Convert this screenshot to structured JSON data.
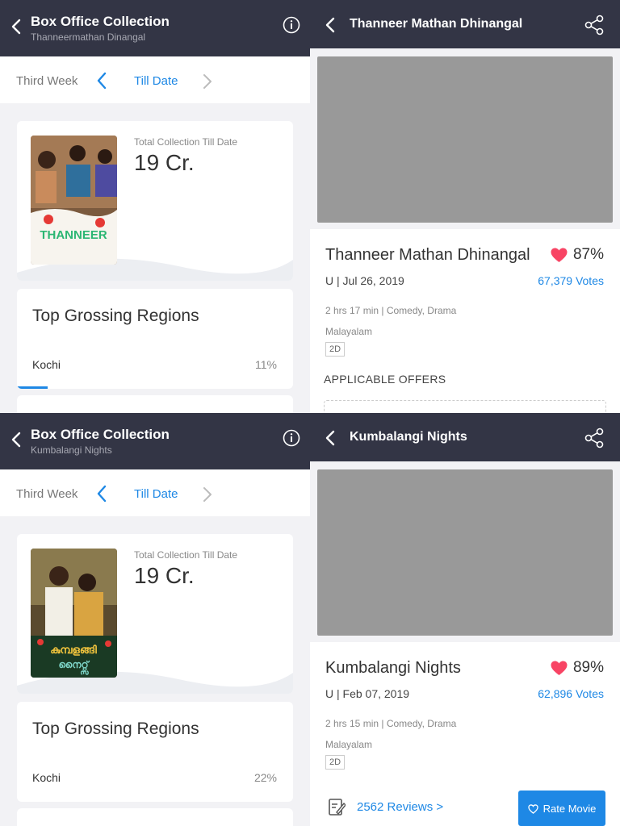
{
  "panels": [
    {
      "header": {
        "title": "Box Office Collection",
        "subtitle": "Thanneermathan Dinangal"
      },
      "week_nav": {
        "previous": "Third Week",
        "current": "Till Date"
      },
      "collection": {
        "label": "Total Collection Till Date",
        "value": "19 Cr."
      },
      "regions": {
        "title": "Top Grossing Regions",
        "items": [
          {
            "name": "Kochi",
            "percent": "11%",
            "fraction": 0.11
          }
        ]
      }
    },
    {
      "header": {
        "title": "Box Office Collection",
        "subtitle": "Kumbalangi Nights"
      },
      "week_nav": {
        "previous": "Third Week",
        "current": "Till Date"
      },
      "collection": {
        "label": "Total Collection Till Date",
        "value": "19 Cr."
      },
      "regions": {
        "title": "Top Grossing Regions",
        "items": [
          {
            "name": "Kochi",
            "percent": "22%",
            "fraction": 0.22
          }
        ]
      }
    }
  ],
  "movies": [
    {
      "header_title": "Thanneer Mathan Dhinangal",
      "name": "Thanneer Mathan Dhinangal",
      "rating": "87%",
      "cert_date": "U | Jul 26, 2019",
      "votes": "67,379 Votes",
      "duration_genre": "2 hrs 17 min | Comedy, Drama",
      "language": "Malayalam",
      "format": "2D",
      "offers_label": "APPLICABLE OFFERS"
    },
    {
      "header_title": "Kumbalangi Nights",
      "name": "Kumbalangi Nights",
      "rating": "89%",
      "cert_date": "U | Feb 07, 2019",
      "votes": "62,896 Votes",
      "duration_genre": "2 hrs 15 min | Comedy, Drama",
      "language": "Malayalam",
      "format": "2D",
      "reviews_link": "2562 Reviews >",
      "rate_button": "Rate Movie"
    }
  ],
  "colors": {
    "header_bg": "#333545",
    "accent": "#1e88e5",
    "heart": "#f84464"
  },
  "icons": [
    "back-icon",
    "info-icon",
    "chevron-left-icon",
    "chevron-right-icon",
    "share-icon",
    "heart-icon",
    "review-icon"
  ]
}
